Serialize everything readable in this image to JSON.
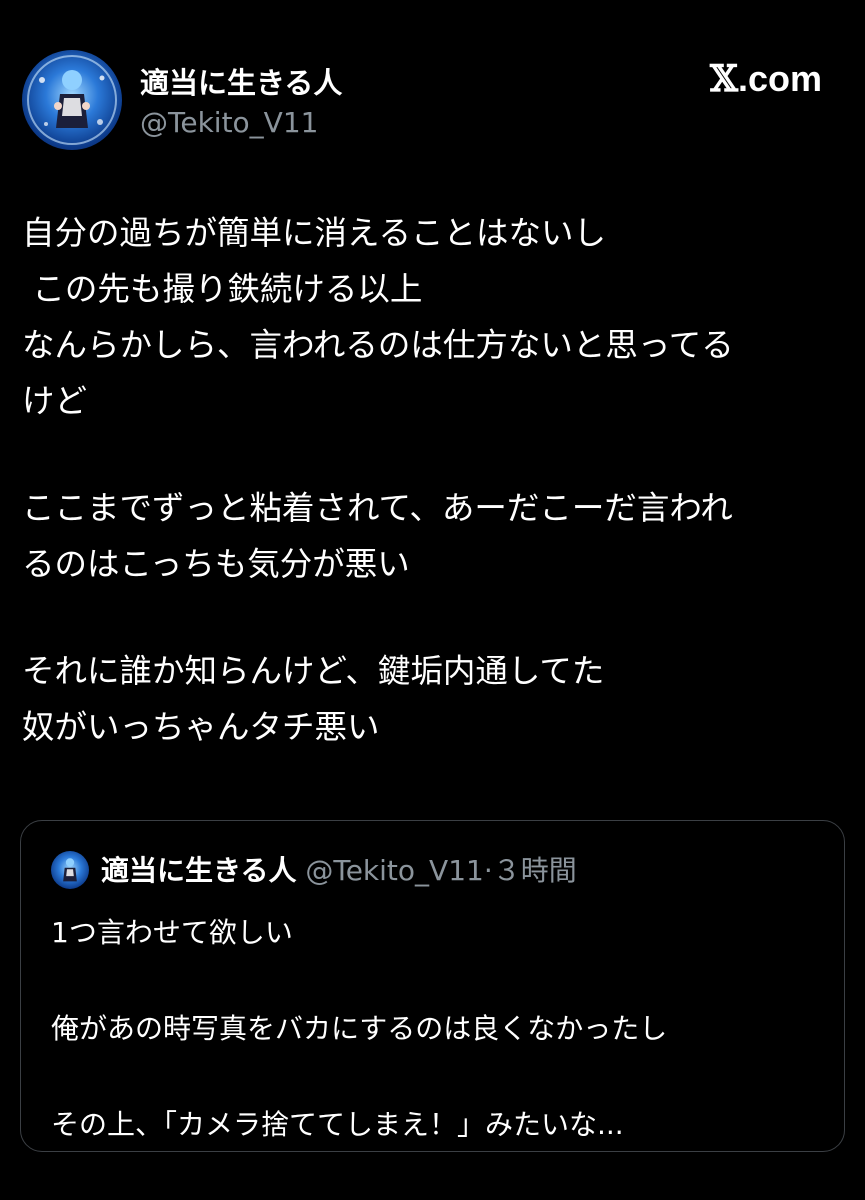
{
  "author": {
    "display_name": "適当に生きる人",
    "handle": "@Tekito_V11"
  },
  "brand": {
    "mark": "𝕏",
    "suffix": ".com"
  },
  "post": {
    "paragraphs": [
      [
        "自分の過ちが簡単に消えることはないし",
        " この先も撮り鉄続ける以上",
        "なんらかしら、言われるのは仕方ないと思ってる",
        "けど"
      ],
      [
        "ここまでずっと粘着されて、あーだこーだ言われ",
        "るのはこっちも気分が悪い"
      ],
      [
        "それに誰か知らんけど、鍵垢内通してた",
        "奴がいっちゃんタチ悪い"
      ]
    ]
  },
  "quoted_post": {
    "display_name": "適当に生きる人",
    "handle": "@Tekito_V11",
    "separator": "·",
    "time": "３時間",
    "lines": [
      "1つ言わせて欲しい",
      "俺があの時写真をバカにするのは良くなかったし",
      "その上、「カメラ捨ててしまえ！」みたいな..."
    ]
  },
  "colors": {
    "background": "#000000",
    "text": "#ffffff",
    "secondary": "#8b949c",
    "border": "#3b3f44"
  }
}
